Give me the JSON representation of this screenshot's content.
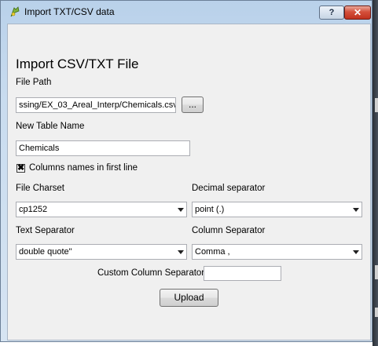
{
  "window": {
    "title": "Import TXT/CSV data"
  },
  "titlebar": {
    "help_label": "?",
    "close_label": "✕"
  },
  "form": {
    "heading": "Import CSV/TXT File",
    "file_path_label": "File Path",
    "file_path_value": "ssing/EX_03_Areal_Interp/Chemicals.csv",
    "browse_label": "...",
    "table_name_label": "New Table Name",
    "table_name_value": "Chemicals",
    "columns_check_label": "Columns names in first line",
    "columns_check_mark": "✖",
    "columns_checked": true,
    "charset_label": "File Charset",
    "charset_value": "cp1252",
    "decimal_label": "Decimal separator",
    "decimal_value": "point (.)",
    "text_sep_label": "Text Separator",
    "text_sep_value": "double quote\"",
    "col_sep_label": "Column Separator",
    "col_sep_value": "Comma ,",
    "custom_sep_label": "Custom Column Separator:",
    "custom_sep_value": "",
    "upload_label": "Upload"
  },
  "icons": {
    "app": "qgis-icon",
    "dropdown": "chevron-down-icon",
    "check": "checkmark-icon"
  },
  "colors": {
    "close_button": "#c0321f",
    "titlebar": "#b9d1ea",
    "client_bg": "#f0f0f0"
  }
}
